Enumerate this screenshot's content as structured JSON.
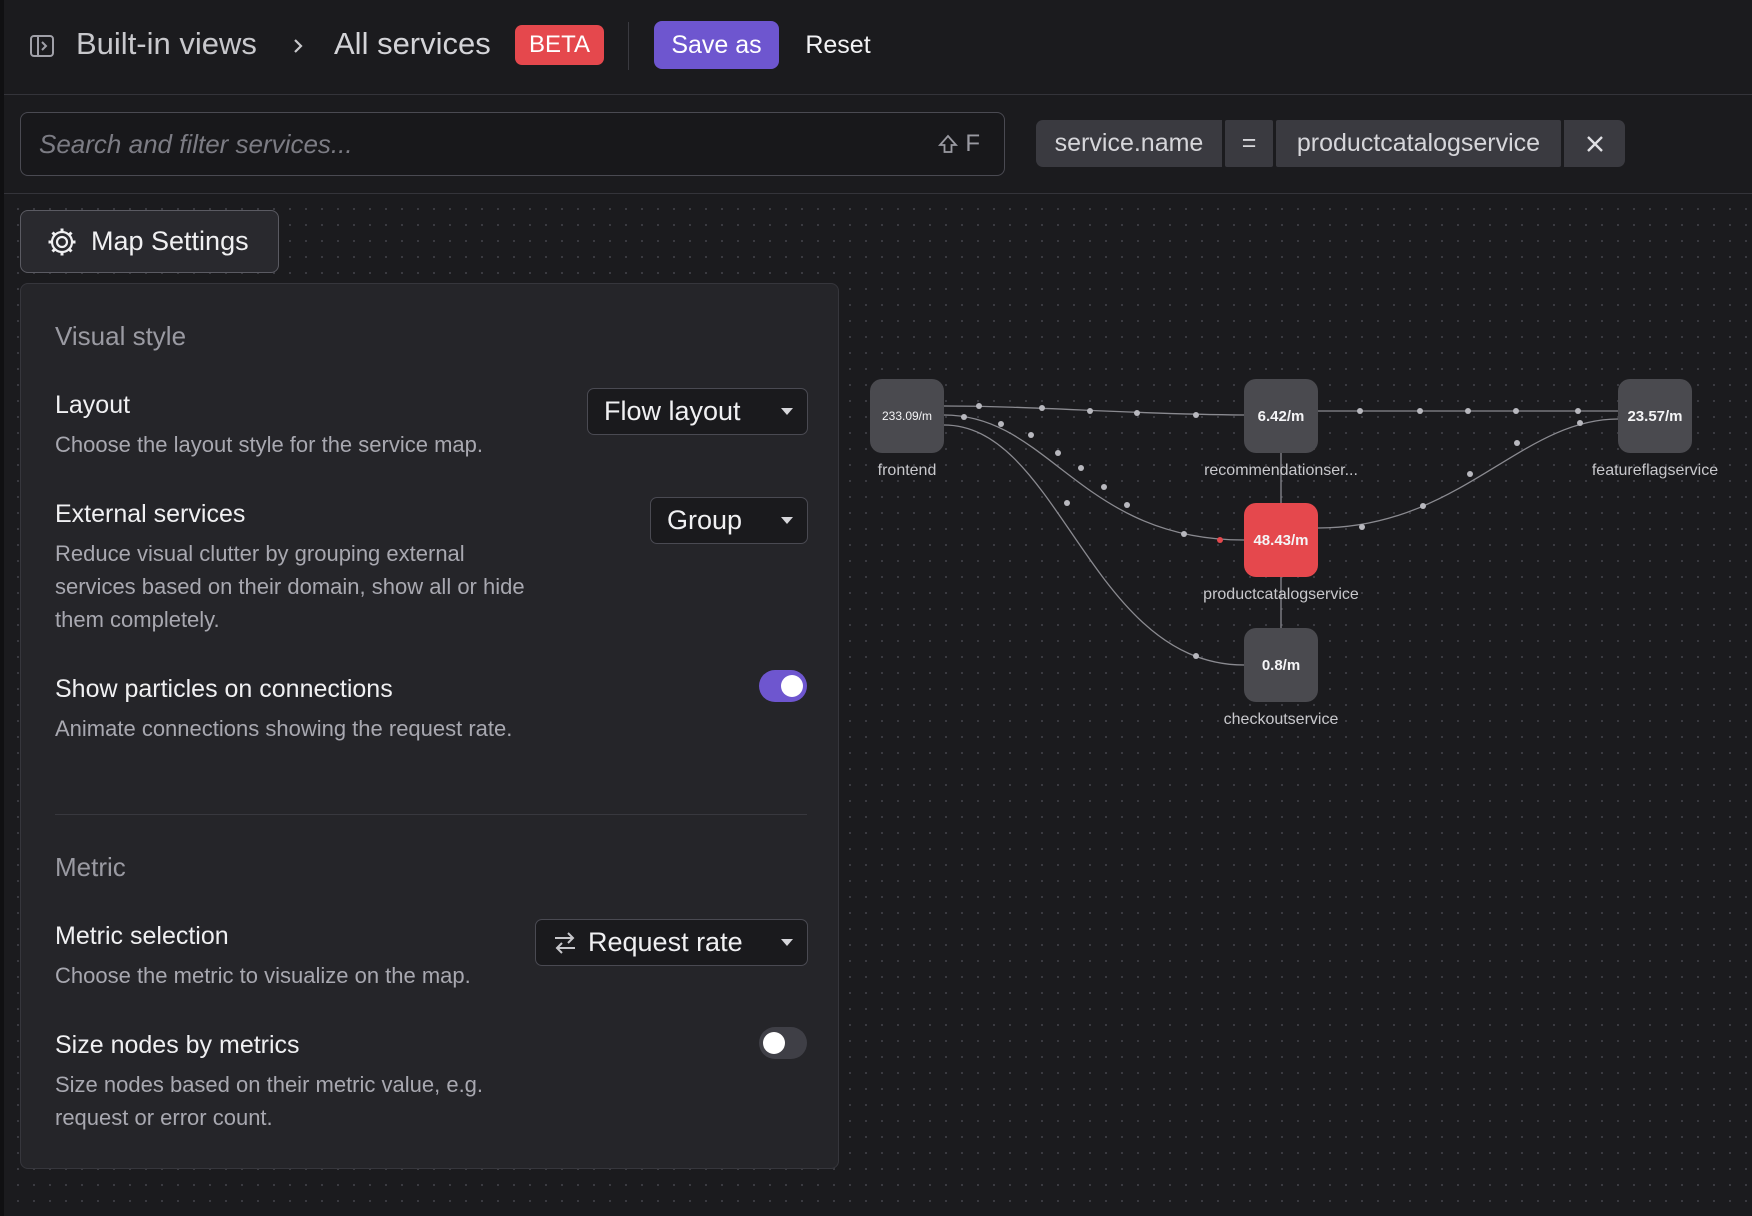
{
  "header": {
    "breadcrumb_root": "Built-in views",
    "breadcrumb_current": "All services",
    "badge": "BETA",
    "save_label": "Save as",
    "reset_label": "Reset"
  },
  "filter": {
    "search_placeholder": "Search and filter services...",
    "shortcut": "F",
    "chip_key": "service.name",
    "chip_operator": "=",
    "chip_value": "productcatalogservice"
  },
  "map_settings": {
    "button_label": "Map Settings",
    "visual_style_title": "Visual style",
    "layout": {
      "title": "Layout",
      "description": "Choose the layout style for the service map.",
      "selected": "Flow layout"
    },
    "external_services": {
      "title": "External services",
      "description": "Reduce visual clutter by grouping external services based on their domain, show all or hide them completely.",
      "selected": "Group"
    },
    "particles": {
      "title": "Show particles on connections",
      "description": "Animate connections showing the request rate.",
      "enabled": true
    },
    "metric_title": "Metric",
    "metric_selection": {
      "title": "Metric selection",
      "description": "Choose the metric to visualize on the map.",
      "selected": "Request rate"
    },
    "size_nodes": {
      "title": "Size nodes by metrics",
      "description": "Size nodes based on their metric value, e.g. request or error count.",
      "enabled": false
    }
  },
  "service_map": {
    "nodes": [
      {
        "name": "frontend",
        "value": "233.09/m"
      },
      {
        "name": "recommendationser...",
        "value": "6.42/m"
      },
      {
        "name": "featureflagservice",
        "value": "23.57/m"
      },
      {
        "name": "productcatalogservice",
        "value": "48.43/m",
        "highlighted": true
      },
      {
        "name": "checkoutservice",
        "value": "0.8/m"
      }
    ],
    "accent_color": "#e5484d"
  }
}
